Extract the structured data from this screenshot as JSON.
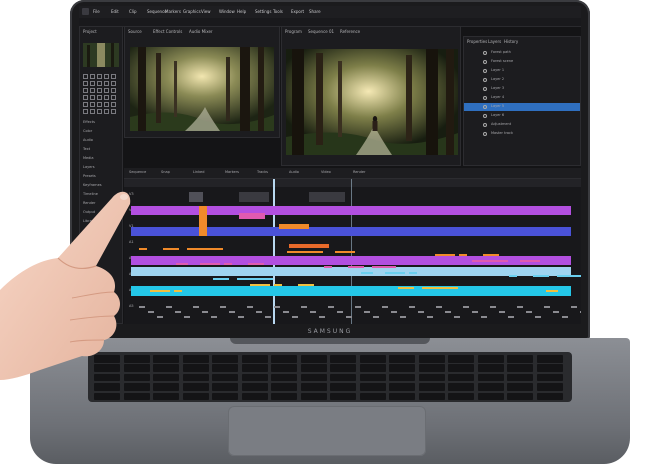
{
  "device": {
    "brand_label": "SAMSUNG"
  },
  "app": {
    "menu": [
      "File",
      "Edit",
      "Clip",
      "Sequence",
      "Markers",
      "Graphics",
      "View",
      "Window",
      "Help",
      "Settings",
      "Tools",
      "Export",
      "Share"
    ],
    "left_panel": {
      "title": "Project",
      "items": [
        "Effects",
        "Color",
        "Audio",
        "Text",
        "Media",
        "Layers",
        "Presets",
        "Keyframes",
        "Timeline",
        "Render",
        "Output",
        "Library"
      ]
    },
    "source_tabs": [
      "Source",
      "Effect Controls",
      "Audio Mixer"
    ],
    "program_tabs": [
      "Program",
      "Sequence 01",
      "Reference"
    ],
    "right_panel": {
      "tabs": [
        "Properties",
        "Layers",
        "History"
      ],
      "rows": [
        "Forest path",
        "Forest scene",
        "Layer 1",
        "Layer 2",
        "Layer 3",
        "Layer 4",
        "Layer 5",
        "Layer 6",
        "Adjustment",
        "Master track"
      ]
    },
    "timeline": {
      "toolbar": [
        "Sequence",
        "Snap",
        "Linked",
        "Markers",
        "Tracks",
        "Audio",
        "Video",
        "Render"
      ],
      "tracks": [
        "V3",
        "V2",
        "V1",
        "A1",
        "A2",
        "A3",
        "A4",
        "A5"
      ]
    }
  },
  "colors": {
    "violet": "#b24fe0",
    "blue": "#4a52d8",
    "cyan": "#24c7e8",
    "light_blue": "#9fd4f0",
    "orange": "#f08a2a",
    "pink": "#e05ab0",
    "accent": "#2f6fbf"
  },
  "icons": [
    "hand-pointing",
    "image-thumbnail",
    "forest-photo",
    "tool-icon"
  ]
}
